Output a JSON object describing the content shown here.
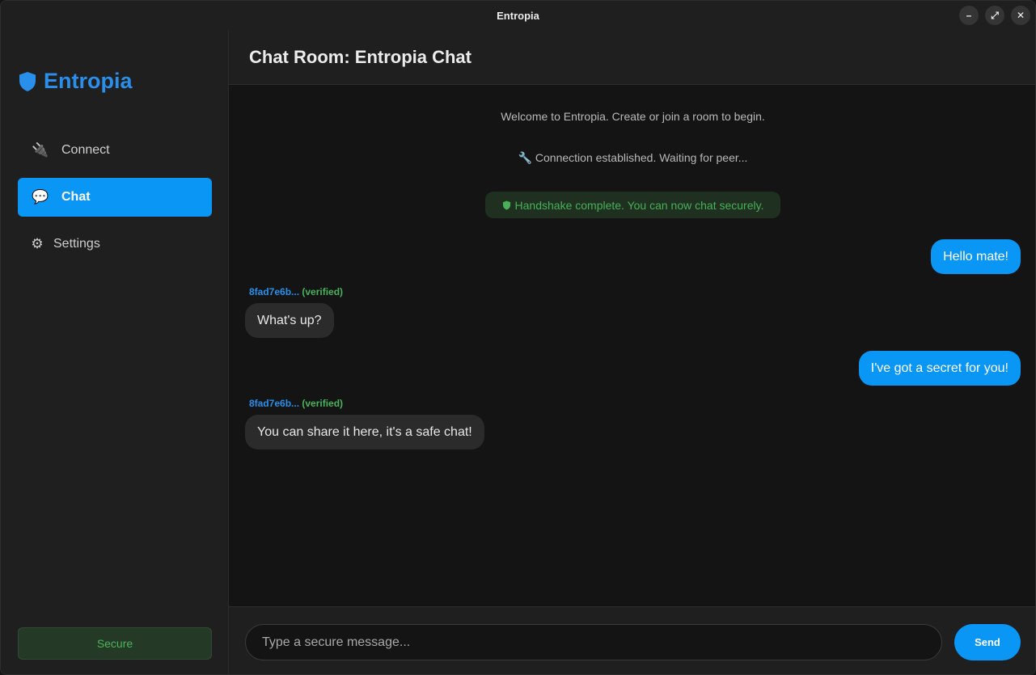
{
  "window": {
    "title": "Entropia",
    "controls": [
      {
        "name": "minimize",
        "glyph": "–"
      },
      {
        "name": "maximize",
        "glyph": "⤢"
      },
      {
        "name": "close",
        "glyph": "✕"
      }
    ]
  },
  "sidebar": {
    "brand": {
      "icon": "shield-icon",
      "name": "Entropia",
      "color": "#2a8fea"
    },
    "items": [
      {
        "icon": "plug-icon",
        "glyph": "🔌",
        "label": "Connect",
        "active": false
      },
      {
        "icon": "chat-bubble-icon",
        "glyph": "💬",
        "label": "Chat",
        "active": true
      },
      {
        "icon": "gear-icon",
        "glyph": "⚙",
        "label": "Settings",
        "active": false
      }
    ],
    "status": "Secure"
  },
  "chat": {
    "title": "Chat Room: Entropia Chat",
    "system_messages": [
      "Welcome to Entropia. Create or join a room to begin.",
      "🔧 Connection established. Waiting for peer..."
    ],
    "handshake": {
      "icon": "shield-icon",
      "text": "Handshake complete. You can now chat securely."
    },
    "messages": [
      {
        "direction": "out",
        "text": "Hello mate!"
      },
      {
        "direction": "in",
        "sender": "8fad7e6b...",
        "verified": "(verified)",
        "text": "What's up?"
      },
      {
        "direction": "out",
        "text": "I've got a secret for you!"
      },
      {
        "direction": "in",
        "sender": "8fad7e6b...",
        "verified": "(verified)",
        "text": "You can share it here, it's a safe chat!"
      }
    ]
  },
  "composer": {
    "placeholder": "Type a secure message...",
    "value": "",
    "send_label": "Send"
  },
  "colors": {
    "accent": "#0a96f5",
    "secure_green": "#4cb35a",
    "background": "#141414",
    "panel": "#1f1f1f"
  }
}
